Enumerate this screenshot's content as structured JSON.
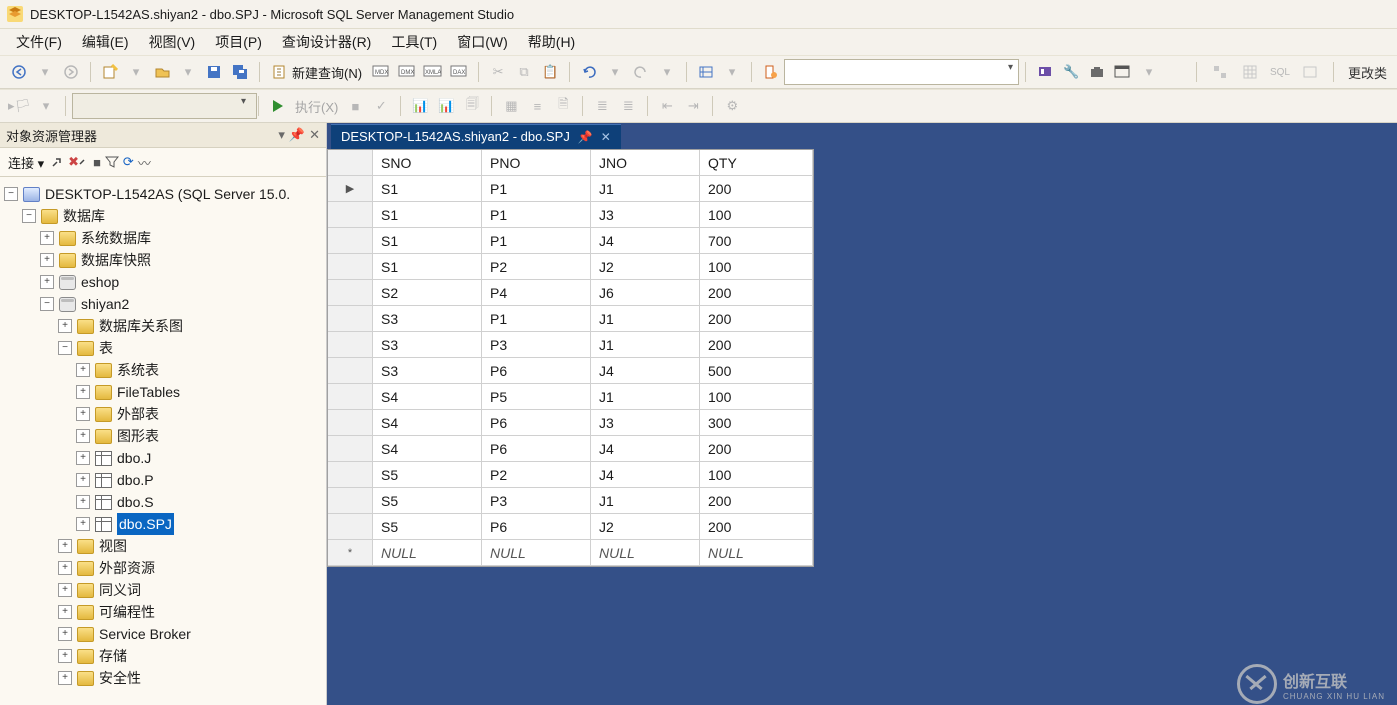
{
  "title": "DESKTOP-L1542AS.shiyan2 - dbo.SPJ - Microsoft SQL Server Management Studio",
  "menu": [
    "文件(F)",
    "编辑(E)",
    "视图(V)",
    "项目(P)",
    "查询设计器(R)",
    "工具(T)",
    "窗口(W)",
    "帮助(H)"
  ],
  "toolbar1": {
    "new_query": "新建查询(N)",
    "change_type": "更改类"
  },
  "toolbar2": {
    "execute": "执行(X)"
  },
  "object_explorer": {
    "title": "对象资源管理器",
    "connect_label": "连接",
    "server": "DESKTOP-L1542AS (SQL Server 15.0.",
    "databases_label": "数据库",
    "sys_db": "系统数据库",
    "db_snapshot": "数据库快照",
    "eshop": "eshop",
    "shiyan2": "shiyan2",
    "db_diagram": "数据库关系图",
    "tables": "表",
    "sys_tables": "系统表",
    "filetables": "FileTables",
    "external_tables": "外部表",
    "graph_tables": "图形表",
    "dbo_j": "dbo.J",
    "dbo_p": "dbo.P",
    "dbo_s": "dbo.S",
    "dbo_spj": "dbo.SPJ",
    "views": "视图",
    "external_resources": "外部资源",
    "synonyms": "同义词",
    "programmability": "可编程性",
    "service_broker": "Service Broker",
    "storage": "存储",
    "security": "安全性"
  },
  "doc_tab": "DESKTOP-L1542AS.shiyan2 - dbo.SPJ",
  "grid": {
    "columns": [
      "SNO",
      "PNO",
      "JNO",
      "QTY"
    ],
    "rows": [
      {
        "SNO": "S1",
        "PNO": "P1",
        "JNO": "J1",
        "QTY": "200"
      },
      {
        "SNO": "S1",
        "PNO": "P1",
        "JNO": "J3",
        "QTY": "100"
      },
      {
        "SNO": "S1",
        "PNO": "P1",
        "JNO": "J4",
        "QTY": "700"
      },
      {
        "SNO": "S1",
        "PNO": "P2",
        "JNO": "J2",
        "QTY": "100"
      },
      {
        "SNO": "S2",
        "PNO": "P4",
        "JNO": "J6",
        "QTY": "200"
      },
      {
        "SNO": "S3",
        "PNO": "P1",
        "JNO": "J1",
        "QTY": "200"
      },
      {
        "SNO": "S3",
        "PNO": "P3",
        "JNO": "J1",
        "QTY": "200"
      },
      {
        "SNO": "S3",
        "PNO": "P6",
        "JNO": "J4",
        "QTY": "500"
      },
      {
        "SNO": "S4",
        "PNO": "P5",
        "JNO": "J1",
        "QTY": "100"
      },
      {
        "SNO": "S4",
        "PNO": "P6",
        "JNO": "J3",
        "QTY": "300"
      },
      {
        "SNO": "S4",
        "PNO": "P6",
        "JNO": "J4",
        "QTY": "200"
      },
      {
        "SNO": "S5",
        "PNO": "P2",
        "JNO": "J4",
        "QTY": "100"
      },
      {
        "SNO": "S5",
        "PNO": "P3",
        "JNO": "J1",
        "QTY": "200"
      },
      {
        "SNO": "S5",
        "PNO": "P6",
        "JNO": "J2",
        "QTY": "200"
      }
    ],
    "null_text": "NULL"
  },
  "watermark": {
    "text": "创新互联",
    "sub": "CHUANG XIN HU LIAN"
  }
}
